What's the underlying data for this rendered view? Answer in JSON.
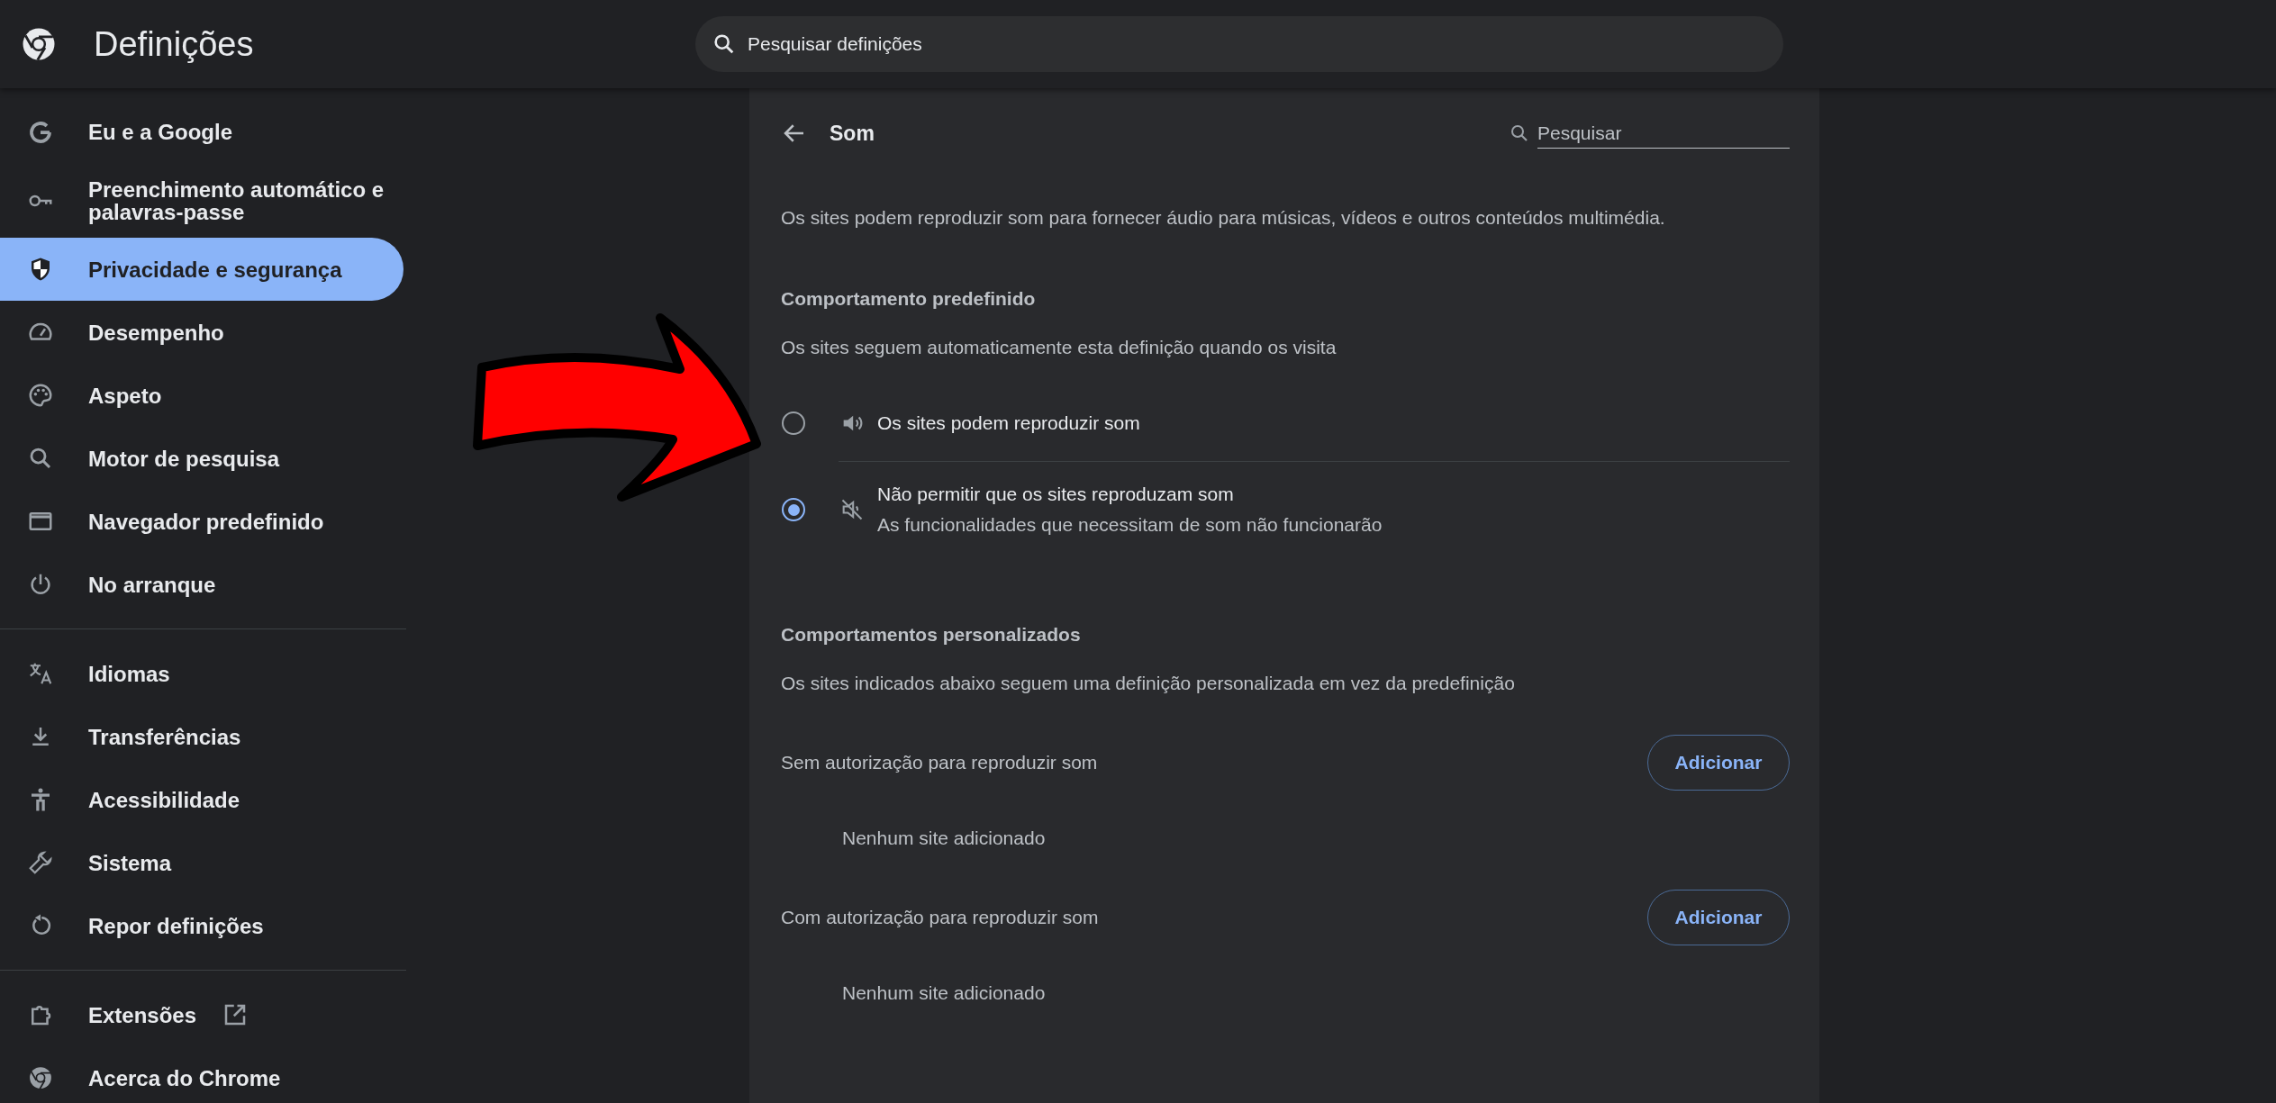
{
  "header": {
    "title": "Definições",
    "search": {
      "placeholder": "Pesquisar definições"
    }
  },
  "sidebar": {
    "groups": [
      {
        "items": [
          {
            "label": "Eu e a Google",
            "selected": false,
            "kind": "page"
          },
          {
            "label": "Preenchimento automático e palavras-passe",
            "selected": false,
            "kind": "page"
          },
          {
            "label": "Privacidade e segurança",
            "selected": true,
            "kind": "page"
          },
          {
            "label": "Desempenho",
            "selected": false,
            "kind": "page"
          },
          {
            "label": "Aspeto",
            "selected": false,
            "kind": "page"
          },
          {
            "label": "Motor de pesquisa",
            "selected": false,
            "kind": "page"
          },
          {
            "label": "Navegador predefinido",
            "selected": false,
            "kind": "page"
          },
          {
            "label": "No arranque",
            "selected": false,
            "kind": "page"
          }
        ]
      },
      {
        "items": [
          {
            "label": "Idiomas",
            "selected": false,
            "kind": "page"
          },
          {
            "label": "Transferências",
            "selected": false,
            "kind": "page"
          },
          {
            "label": "Acessibilidade",
            "selected": false,
            "kind": "page"
          },
          {
            "label": "Sistema",
            "selected": false,
            "kind": "page"
          },
          {
            "label": "Repor definições",
            "selected": false,
            "kind": "page"
          }
        ]
      },
      {
        "items": [
          {
            "label": "Extensões",
            "selected": false,
            "kind": "external"
          },
          {
            "label": "Acerca do Chrome",
            "selected": false,
            "kind": "page"
          }
        ]
      }
    ]
  },
  "panel": {
    "title": "Som",
    "search": {
      "placeholder": "Pesquisar"
    },
    "description": "Os sites podem reproduzir som para fornecer áudio para músicas, vídeos e outros conteúdos multimédia.",
    "default_behavior": {
      "heading": "Comportamento predefinido",
      "subtitle": "Os sites seguem automaticamente esta definição quando os visita",
      "options": [
        {
          "label": "Os sites podem reproduzir som",
          "selected": false,
          "kind": "sound"
        },
        {
          "label": "Não permitir que os sites reproduzam som",
          "sublabel": "As funcionalidades que necessitam de som não funcionarão",
          "selected": true,
          "kind": "muted"
        }
      ]
    },
    "custom_behaviors": {
      "heading": "Comportamentos personalizados",
      "subtitle": "Os sites indicados abaixo seguem uma definição personalizada em vez da predefinição",
      "lists": [
        {
          "label": "Sem autorização para reproduzir som",
          "button": "Adicionar",
          "empty": "Nenhum site adicionado"
        },
        {
          "label": "Com autorização para reproduzir som",
          "button": "Adicionar",
          "empty": "Nenhum site adicionado"
        }
      ]
    }
  },
  "annotation": {
    "kind": "arrow"
  }
}
